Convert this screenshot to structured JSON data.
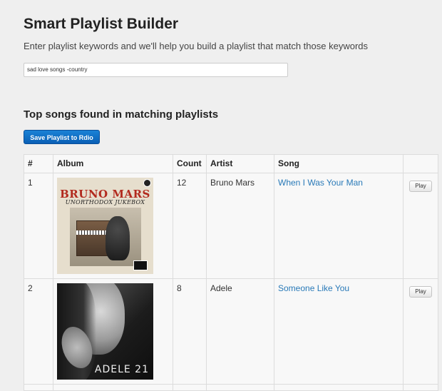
{
  "page": {
    "title": "Smart Playlist Builder",
    "subtitle": "Enter playlist keywords and we'll help you build a playlist that match those keywords"
  },
  "search": {
    "value": "sad love songs -country"
  },
  "results": {
    "heading": "Top songs found in matching playlists",
    "save_label": "Save Playlist to Rdio"
  },
  "table": {
    "columns": {
      "num": "#",
      "album": "Album",
      "count": "Count",
      "artist": "Artist",
      "song": "Song"
    },
    "rows": [
      {
        "num": "1",
        "count": "12",
        "artist": "Bruno Mars",
        "song": "When I Was Your Man",
        "play_label": "Play",
        "album_cover": {
          "title": "BRUNO MARS",
          "subtitle": "UNORTHODOX JUKEBOX"
        }
      },
      {
        "num": "2",
        "count": "8",
        "artist": "Adele",
        "song": "Someone Like You",
        "play_label": "Play",
        "album_cover": {
          "title": "ADELE 21"
        }
      }
    ]
  },
  "colors": {
    "background": "#efefef",
    "accent": "#0a5fb5",
    "link": "#2a7ab8",
    "cover_title_red": "#b22a1e"
  }
}
